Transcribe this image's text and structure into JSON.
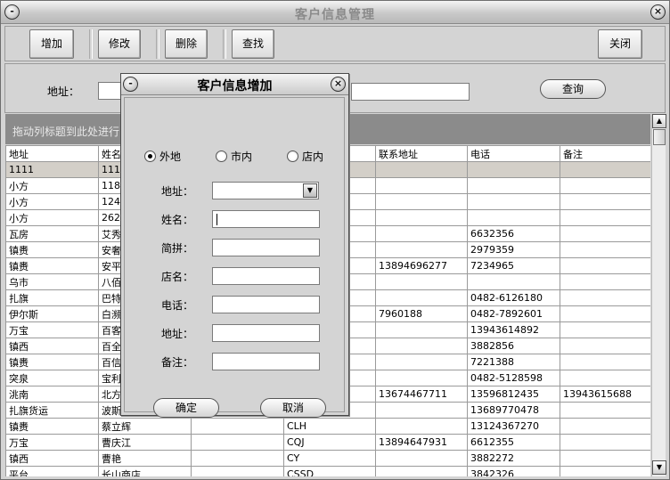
{
  "window": {
    "title": "客户信息管理"
  },
  "toolbar": {
    "add": "增加",
    "edit": "修改",
    "delete": "删除",
    "find": "查找",
    "close": "关闭"
  },
  "search": {
    "address_label": "地址：",
    "query_button": "查询"
  },
  "group_hint": "拖动列标题到此处进行",
  "table": {
    "headers": [
      "地址",
      "姓名",
      "",
      "",
      "联系地址",
      "电话",
      "备注"
    ],
    "rows": [
      [
        "1111",
        "1111",
        "",
        "",
        "",
        "",
        ""
      ],
      [
        "小方",
        "1182",
        "",
        "",
        "",
        "",
        ""
      ],
      [
        "小方",
        "124",
        "",
        "",
        "",
        "",
        ""
      ],
      [
        "小方",
        "262",
        "",
        "",
        "",
        "",
        ""
      ],
      [
        "瓦房",
        "艾秀",
        "",
        "",
        "",
        "6632356",
        ""
      ],
      [
        "镇赉",
        "安奢",
        "",
        "",
        "",
        "2979359",
        ""
      ],
      [
        "镇赉",
        "安平",
        "",
        "",
        "13894696277",
        "7234965",
        ""
      ],
      [
        "乌市",
        "八佰",
        "",
        "",
        "",
        "",
        ""
      ],
      [
        "扎旗",
        "巴特",
        "",
        "",
        "",
        "0482-6126180",
        ""
      ],
      [
        "伊尔斯",
        "白濒",
        "",
        "",
        "7960188",
        "0482-7892601",
        ""
      ],
      [
        "万宝",
        "百客",
        "",
        "",
        "",
        "13943614892",
        ""
      ],
      [
        "镇西",
        "百全",
        "",
        "",
        "",
        "3882856",
        ""
      ],
      [
        "镇赉",
        "百信",
        "",
        "",
        "",
        "7221388",
        ""
      ],
      [
        "突泉",
        "宝利",
        "",
        "",
        "",
        "0482-5128598",
        ""
      ],
      [
        "洮南",
        "北方",
        "",
        "",
        "13674467711",
        "13596812435",
        "13943615688"
      ],
      [
        "扎旗货运",
        "波斯",
        "",
        "",
        "",
        "13689770478",
        ""
      ],
      [
        "镇赉",
        "蔡立辉",
        "",
        "CLH",
        "",
        "13124367270",
        ""
      ],
      [
        "万宝",
        "曹庆江",
        "",
        "CQJ",
        "13894647931",
        "6612355",
        ""
      ],
      [
        "镇西",
        "曹艳",
        "",
        "CY",
        "",
        "3882272",
        ""
      ],
      [
        "平台",
        "长山商店",
        "",
        "CSSD",
        "",
        "3842326",
        ""
      ]
    ]
  },
  "dialog": {
    "title": "客户信息增加",
    "radios": [
      "外地",
      "市内",
      "店内"
    ],
    "selected_radio": "外地",
    "labels": {
      "region": "地址：",
      "name": "姓名：",
      "pinyin": "简拼：",
      "store": "店名：",
      "phone": "电话：",
      "address": "地址：",
      "note": "备注："
    },
    "ok": "确定",
    "cancel": "取消"
  },
  "icons": {
    "window_menu": "system-menu-icon",
    "window_close": "close-icon",
    "combo": "chevron-down-icon",
    "scroll_up": "arrow-up-icon",
    "scroll_down": "arrow-down-icon"
  }
}
